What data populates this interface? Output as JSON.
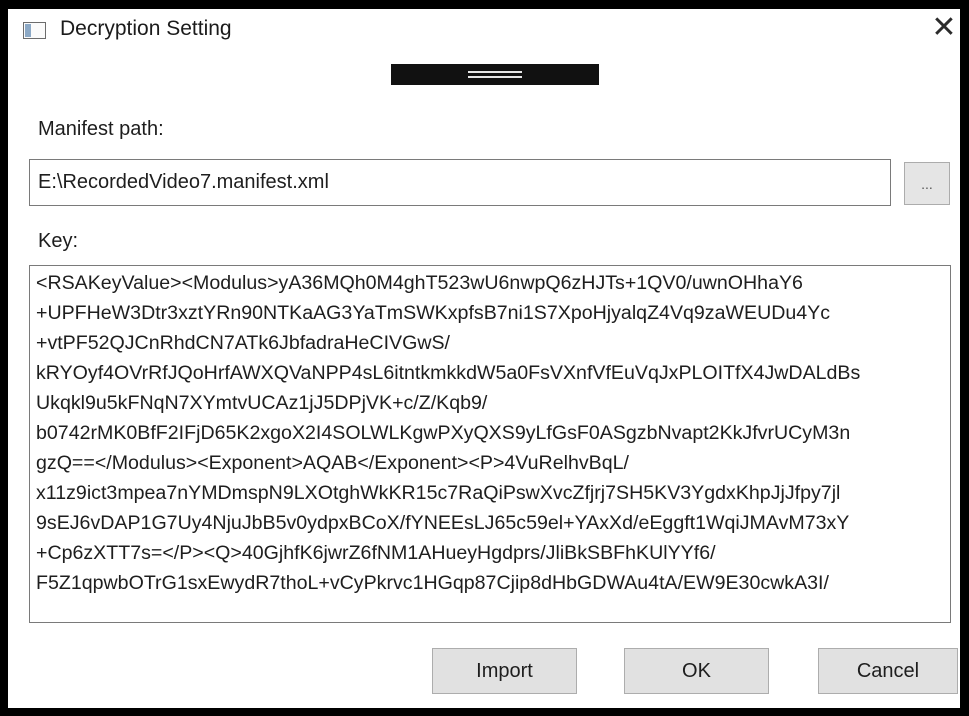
{
  "window": {
    "title": "Decryption Setting",
    "close_glyph": "✕"
  },
  "manifest": {
    "label": "Manifest path:",
    "value": "E:\\RecordedVideo7.manifest.xml",
    "browse_label": "..."
  },
  "key": {
    "label": "Key:",
    "lines": [
      "<RSAKeyValue><Modulus>yA36MQh0M4ghT523wU6nwpQ6zHJTs+1QV0/uwnOHhaY6",
      "+UPFHeW3Dtr3xztYRn90NTKaAG3YaTmSWKxpfsB7ni1S7XpoHjyalqZ4Vq9zaWEUDu4Yc",
      "+vtPF52QJCnRhdCN7ATk6JbfadraHeCIVGwS/",
      "kRYOyf4OVrRfJQoHrfAWXQVaNPP4sL6itntkmkkdW5a0FsVXnfVfEuVqJxPLOITfX4JwDALdBs",
      "Ukqkl9u5kFNqN7XYmtvUCAz1jJ5DPjVK+c/Z/Kqb9/",
      "b0742rMK0BfF2IFjD65K2xgoX2I4SOLWLKgwPXyQXS9yLfGsF0ASgzbNvapt2KkJfvrUCyM3n",
      "gzQ==</Modulus><Exponent>AQAB</Exponent><P>4VuRelhvBqL/",
      "x11z9ict3mpea7nYMDmspN9LXOtghWkKR15c7RaQiPswXvcZfjrj7SH5KV3YgdxKhpJjJfpy7jl",
      "9sEJ6vDAP1G7Uy4NjuJbB5v0ydpxBCoX/fYNEEsLJ65c59el+YAxXd/eEggft1WqiJMAvM73xY",
      "+Cp6zXTT7s=</P><Q>40GjhfK6jwrZ6fNM1AHueyHgdprs/JliBkSBFhKUlYYf6/",
      "F5Z1qpwbOTrG1sxEwydR7thoL+vCyPkrvc1HGqp87Cjip8dHbGDWAu4tA/EW9E30cwkA3I/"
    ]
  },
  "actions": {
    "import_label": "Import",
    "ok_label": "OK",
    "cancel_label": "Cancel"
  }
}
